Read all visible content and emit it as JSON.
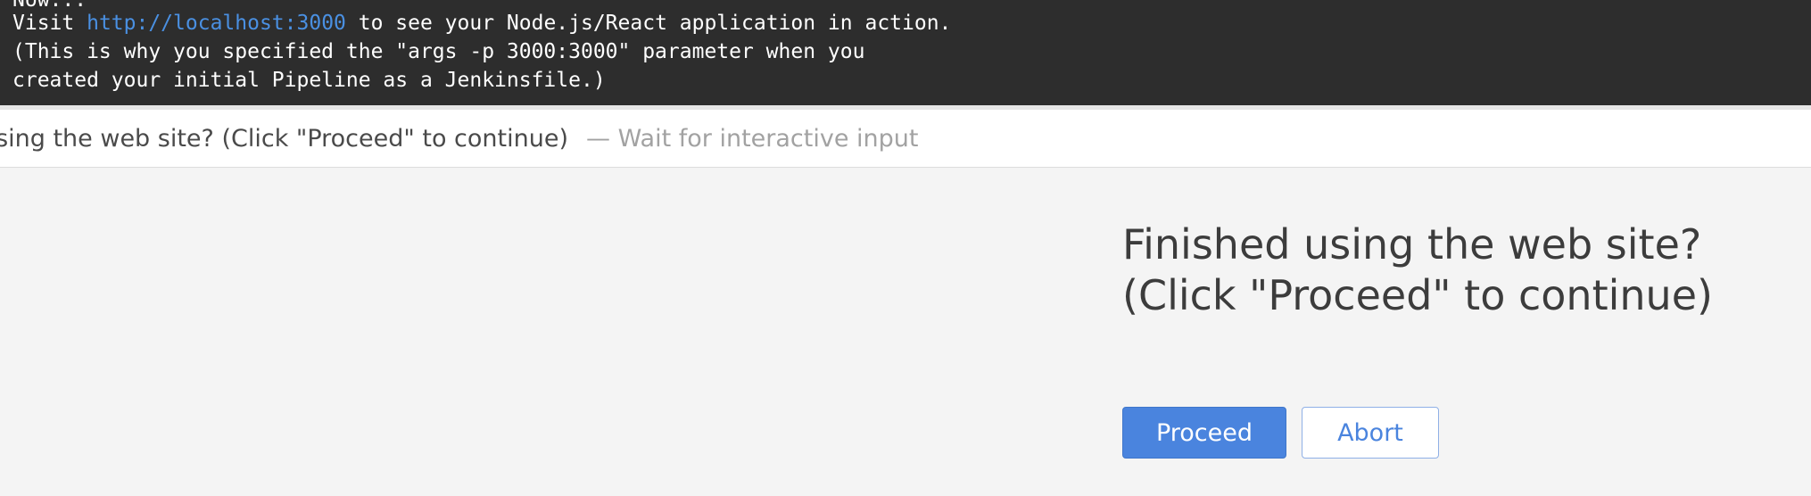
{
  "console": {
    "line0": "Now...",
    "line1_prefix": "Visit ",
    "line1_link": "http://localhost:3000",
    "line1_suffix": " to see your Node.js/React application in action.",
    "line2": "(This is why you specified the \"args -p 3000:3000\" parameter when you",
    "line3": "created your initial Pipeline as a Jenkinsfile.)"
  },
  "step": {
    "text": "Finished using the web site? (Click \"Proceed\" to continue)",
    "status": "— Wait for interactive input"
  },
  "prompt": {
    "message": "Finished using the web site? (Click \"Proceed\" to continue)",
    "proceed_label": "Proceed",
    "abort_label": "Abort"
  },
  "colors": {
    "console_bg": "#2d2d2d",
    "link": "#4a90e2",
    "primary": "#4a84de",
    "panel_bg": "#f4f4f4"
  }
}
